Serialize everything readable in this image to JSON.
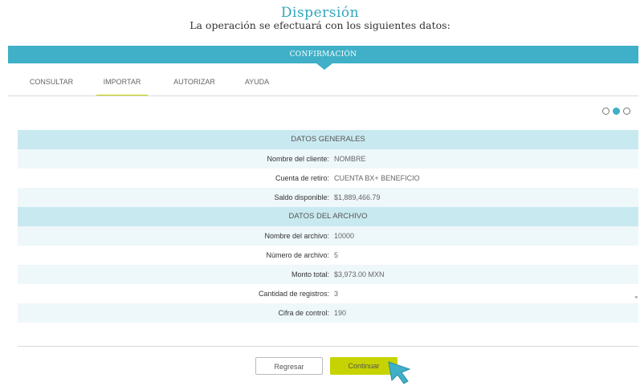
{
  "header": {
    "title": "Dispersión",
    "subtitle": "La operación se efectuará con los siguientes datos:"
  },
  "banner": {
    "label": "CONFIRMACIÓN"
  },
  "tabs": [
    {
      "label": "CONSULTAR",
      "active": false
    },
    {
      "label": "IMPORTAR",
      "active": true
    },
    {
      "label": "AUTORIZAR",
      "active": false
    },
    {
      "label": "AYUDA",
      "active": false
    }
  ],
  "steps": {
    "total": 3,
    "current": 2
  },
  "sections": {
    "general": {
      "title": "DATOS GENERALES",
      "rows": [
        {
          "label": "Nombre del cliente:",
          "value": "NOMBRE"
        },
        {
          "label": "Cuenta de retiro:",
          "value": "CUENTA BX+ BENEFICIO"
        },
        {
          "label": "Saldo disponible:",
          "value": "$1,889,466.79"
        }
      ]
    },
    "file": {
      "title": "DATOS DEL ARCHIVO",
      "rows": [
        {
          "label": "Nombre del archivo:",
          "value": "10000"
        },
        {
          "label": "Número de archivo:",
          "value": "5"
        },
        {
          "label": "Monto total:",
          "value": "$3,973.00 MXN"
        },
        {
          "label": "Cantidad de registros:",
          "value": "3"
        },
        {
          "label": "Cifra de control:",
          "value": "190"
        }
      ]
    }
  },
  "buttons": {
    "back": "Regresar",
    "next": "Continuar"
  },
  "colors": {
    "accent": "#3fb0c7",
    "highlight": "#c7d300",
    "section_bg": "#c9e9f0",
    "row_alt": "#eef7fa"
  },
  "icons": {
    "cursor": "pointer-arrow-icon"
  }
}
